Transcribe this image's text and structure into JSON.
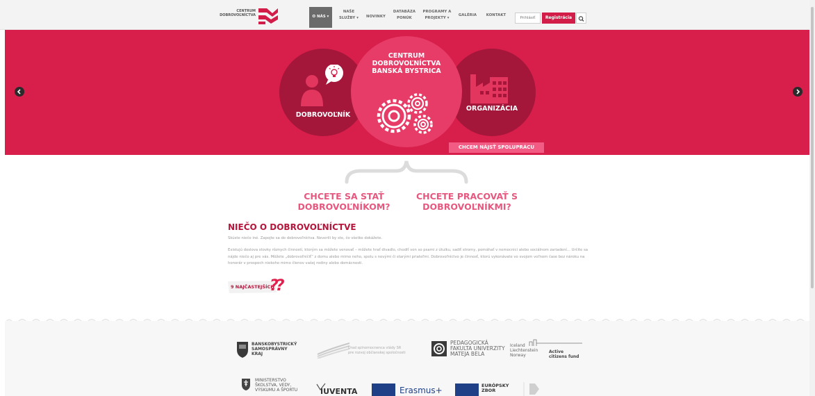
{
  "logo": {
    "line1": "CENTRUM",
    "line2": "DOBROVOĽNÍCTVA"
  },
  "nav": [
    {
      "line1": "O NÁS ▾",
      "line2": ""
    },
    {
      "line1": "NAŠE",
      "line2": "SLUŽBY ▾"
    },
    {
      "line1": "NOVINKY",
      "line2": ""
    },
    {
      "line1": "DATABÁZA",
      "line2": "PONÚK"
    },
    {
      "line1": "PROGRAMY A",
      "line2": "PROJEKTY ▾"
    },
    {
      "line1": "GALÉRIA",
      "line2": ""
    },
    {
      "line1": "KONTAKT",
      "line2": ""
    }
  ],
  "auth": {
    "login": "Prihlásiť",
    "register": "Registrácia"
  },
  "hero": {
    "title_line1": "CENTRUM",
    "title_line2": "DOBROVOĽNÍCTVA",
    "title_line3": "BANSKÁ BYSTRICA",
    "left_label": "DOBROVOĽNÍK",
    "right_label": "ORGANIZÁCIA",
    "cta": "CHCEM NÁJSŤ SPOLUPRÁCU"
  },
  "choices": {
    "left_line1": "CHCETE SA STAŤ",
    "left_line2": "DOBROVOĽNÍKOM?",
    "right_line1": "CHCETE PRACOVAŤ S",
    "right_line2": "DOBROVOĽNÍKMI?"
  },
  "about": {
    "title": "NIEČO O DOBROVOĽNÍCTVE",
    "lead": "Skúste niečo iné. Zapojte sa do dobrovoľníctva. Neverili by ste, čo všetko dokážete.",
    "body": "Existujú doslova stovky rôznych činností, ktorým sa môžete venovať – môžete hrať divadlo, chodiť von so psami z útulku, sadiť stromy, pomáhať v nemocnici alebo sociálnom zariadení... Určite sa nájde niečo aj pre vás. Môžete „dobrovoľničiť“ z domu alebo mimo neho, spolu s novými či starými priateľmi. Dobrovoľníctvo je činnosť, ktorú vykonávate vo svojom voľnom čase bez nároku na honorár v prospech niekoho mimo členov vašej rodiny alebo domácnosti.",
    "faq_label": "9 NAJČASTEJŠÍCH",
    "faq_marks": "??"
  },
  "partners": {
    "bbsk": {
      "line1": "BANSKOBYSTRICKÝ",
      "line2": "SAMOSPRÁVNY",
      "line3": "KRAJ"
    },
    "urad": {
      "line1": "Úrad splnomocnenca vlády SR",
      "line2": "pre rozvoj občianskej spoločnosti"
    },
    "umb": {
      "line1": "PEDAGOGICKÁ",
      "line2": "FAKULTA UNIVERZITY",
      "line3": "MATEJA BELA"
    },
    "eea": {
      "line1": "Iceland",
      "line2": "Liechtenstein",
      "line3": "Norway",
      "line4": "Active",
      "line5": "citizens fund"
    },
    "ministry": {
      "line1": "MINISTERSTVO",
      "line2": "ŠKOLSTVA, VEDY,",
      "line3": "VÝSKUMU A ŠPORTU"
    },
    "iuventa": "IUVENTA",
    "erasmus": "Erasmus+",
    "esc": {
      "line1": "EURÓPSKY",
      "line2": "ZBOR"
    }
  },
  "colors": {
    "brand": "#d81e4a",
    "dark": "#a4163a",
    "accent": "#e73c68"
  }
}
